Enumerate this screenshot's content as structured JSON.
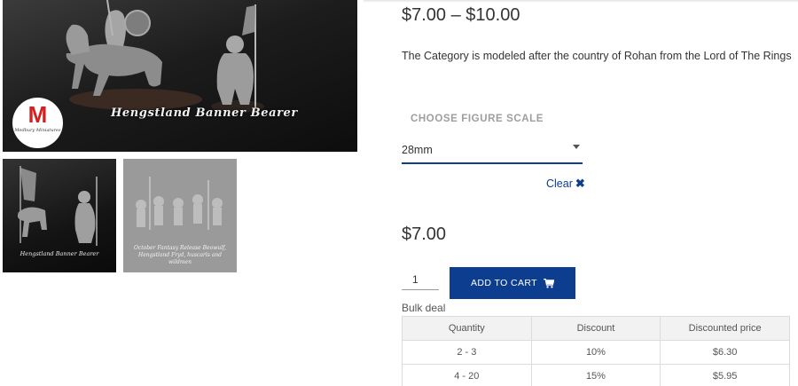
{
  "gallery": {
    "main_caption": "Hengstland Banner Bearer",
    "logo_letter": "M",
    "logo_subtitle": "Medbury Miniatures",
    "thumbnails": [
      {
        "caption": "Hengstland Banner Bearer"
      },
      {
        "caption": "October Fantasy Release Beowulf, Hengstland Fryd, huscarls and wildmen"
      }
    ]
  },
  "product": {
    "price_range": "$7.00 – $10.00",
    "description": "The Category is modeled after the country of Rohan from the Lord of The Rings",
    "scale_label": "CHOOSE FIGURE SCALE",
    "scale_selected": "28mm",
    "clear_label": "Clear",
    "price": "$7.00",
    "quantity": "1",
    "add_to_cart_label": "ADD TO CART",
    "bulk_label": "Bulk deal"
  },
  "bulk_table": {
    "headers": [
      "Quantity",
      "Discount",
      "Discounted price"
    ],
    "rows": [
      [
        "2 - 3",
        "10%",
        "$6.30"
      ],
      [
        "4 - 20",
        "15%",
        "$5.95"
      ]
    ]
  },
  "colors": {
    "accent": "#0d3d8f",
    "logo_red": "#d32020"
  },
  "icons": {
    "clear": "close-icon",
    "cart": "shopping-cart-icon",
    "select": "chevron-down-icon"
  }
}
